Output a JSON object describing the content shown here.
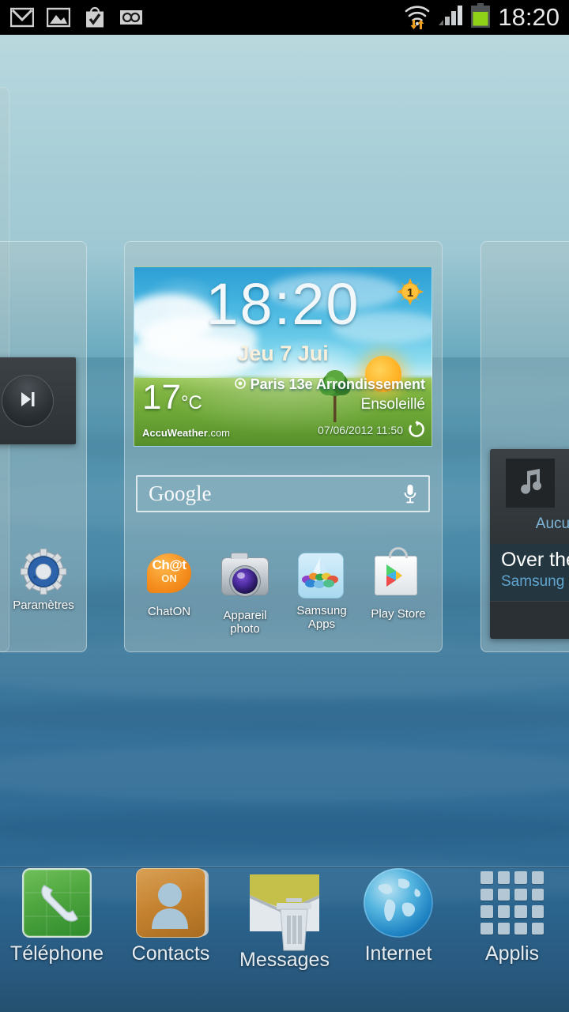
{
  "status_bar": {
    "left_icons": [
      {
        "name": "gmail-icon",
        "label": "Gmail"
      },
      {
        "name": "gallery-icon",
        "label": "Gallery"
      },
      {
        "name": "play-store-installed-icon",
        "label": "App installed"
      },
      {
        "name": "voicemail-icon",
        "label": "Voicemail"
      }
    ],
    "right_icons": [
      {
        "name": "wifi-icon",
        "label": "Wi-Fi with data transfer"
      },
      {
        "name": "signal-icon",
        "label": "Mobile signal"
      },
      {
        "name": "battery-icon",
        "label": "Battery"
      }
    ],
    "clock": "18:20",
    "battery_level_pct": 62,
    "signal_bars": 3
  },
  "weather_widget": {
    "time": "18:20",
    "date": "Jeu 7 Jui",
    "temperature": "17",
    "temperature_unit": "°C",
    "city": "Paris 13e Arrondissement",
    "condition": "Ensoleillé",
    "provider": "AccuWeather",
    "provider_suffix": ".com",
    "updated": "07/06/2012 11:50",
    "city_count_badge": "1",
    "refresh_icon": "refresh-icon",
    "location_icon": "location-icon"
  },
  "search": {
    "label": "Google",
    "placeholder": "Google",
    "mic_icon": "microphone-icon"
  },
  "home_apps": [
    {
      "name": "chaton",
      "label": "ChatON",
      "icon": "chaton-icon",
      "badge_top": "Ch@t",
      "badge_bottom": "ON"
    },
    {
      "name": "camera",
      "label": "Appareil photo",
      "icon": "camera-icon"
    },
    {
      "name": "samsung-apps",
      "label": "Samsung Apps",
      "icon": "samsung-apps-icon"
    },
    {
      "name": "play-store",
      "label": "Play Store",
      "icon": "play-store-icon"
    }
  ],
  "left_page": {
    "settings_app": {
      "label": "Paramètres",
      "icon": "gear-icon"
    },
    "next_track_widget": {
      "icon": "next-track-icon"
    }
  },
  "right_page": {
    "music_widget": {
      "note_icon": "music-note-icon",
      "none_label": "Aucune",
      "track_title": "Over the H",
      "artist": "Samsung"
    }
  },
  "dock": [
    {
      "name": "phone",
      "label": "Téléphone",
      "icon": "phone-icon"
    },
    {
      "name": "contacts",
      "label": "Contacts",
      "icon": "contacts-icon"
    },
    {
      "name": "messages",
      "label": "Messages",
      "icon": "messages-icon",
      "overlay_icon": "trash-icon"
    },
    {
      "name": "internet",
      "label": "Internet",
      "icon": "globe-icon"
    },
    {
      "name": "applis",
      "label": "Applis",
      "icon": "app-grid-icon"
    }
  ],
  "colors": {
    "status_bar_bg": "#000000",
    "wallpaper_top": "#b9d8de",
    "wallpaper_bottom": "#24506f",
    "battery_green": "#8fd117",
    "wifi_arrow_orange": "#f0a020",
    "accent_blue": "#5fa5d0",
    "pane_fill": "rgba(176,195,198,0.42)"
  }
}
